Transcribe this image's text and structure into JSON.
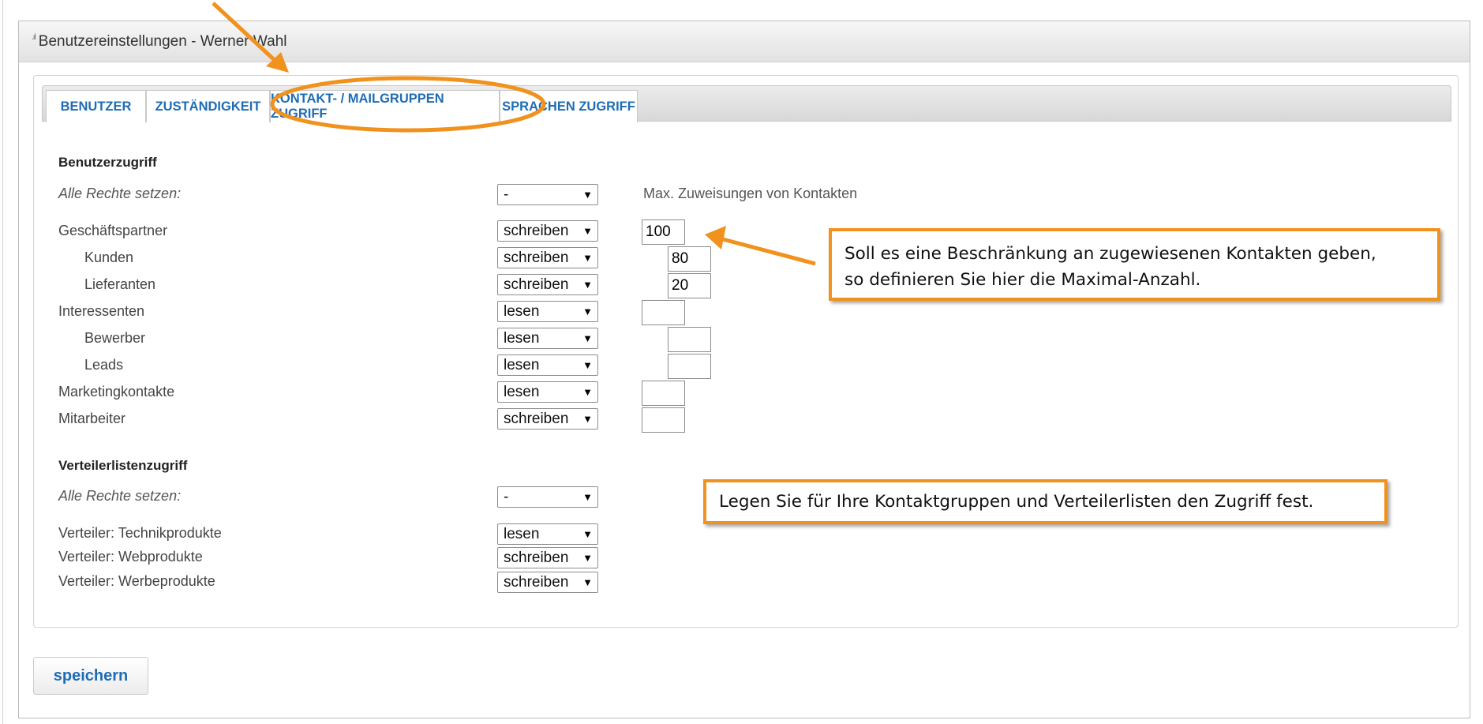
{
  "window": {
    "title": "Benutzereinstellungen - Werner Wahl"
  },
  "tabs": [
    {
      "label": "BENUTZER"
    },
    {
      "label": "ZUSTÄNDIGKEIT"
    },
    {
      "label": "KONTAKT- / MAILGRUPPEN ZUGRIFF"
    },
    {
      "label": "SPRACHEN ZUGRIFF"
    }
  ],
  "user_access": {
    "heading": "Benutzerzugriff",
    "all_rights_label": "Alle Rechte setzen:",
    "all_rights_value": "-",
    "max_header": "Max. Zuweisungen von Kontakten",
    "rows": [
      {
        "label": "Geschäftspartner",
        "access": "schreiben",
        "max": "100"
      },
      {
        "label": "Kunden",
        "access": "schreiben",
        "max": "80"
      },
      {
        "label": "Lieferanten",
        "access": "schreiben",
        "max": "20"
      },
      {
        "label": "Interessenten",
        "access": "lesen",
        "max": ""
      },
      {
        "label": "Bewerber",
        "access": "lesen",
        "max": ""
      },
      {
        "label": "Leads",
        "access": "lesen",
        "max": ""
      },
      {
        "label": "Marketingkontakte",
        "access": "lesen",
        "max": ""
      },
      {
        "label": "Mitarbeiter",
        "access": "schreiben",
        "max": ""
      }
    ]
  },
  "distribution_access": {
    "heading": "Verteilerlistenzugriff",
    "all_rights_label": "Alle Rechte setzen:",
    "all_rights_value": "-",
    "rows": [
      {
        "label": "Verteiler: Technikprodukte",
        "access": "lesen"
      },
      {
        "label": "Verteiler: Webprodukte",
        "access": "schreiben"
      },
      {
        "label": "Verteiler: Werbeprodukte",
        "access": "schreiben"
      }
    ]
  },
  "callouts": {
    "limit_line1": "Soll es eine Beschränkung an zugewiesenen Kontakten geben,",
    "limit_line2": "so definieren Sie hier die Maximal-Anzahl.",
    "groups": "Legen Sie für Ihre Kontaktgruppen und Verteilerlisten den Zugriff  fest."
  },
  "save_label": "speichern",
  "colors": {
    "accent": "#f0921d",
    "link": "#1e6db4"
  },
  "icons": {
    "title": "signal-bars-icon",
    "select": "dropdown-triangle-icon"
  }
}
